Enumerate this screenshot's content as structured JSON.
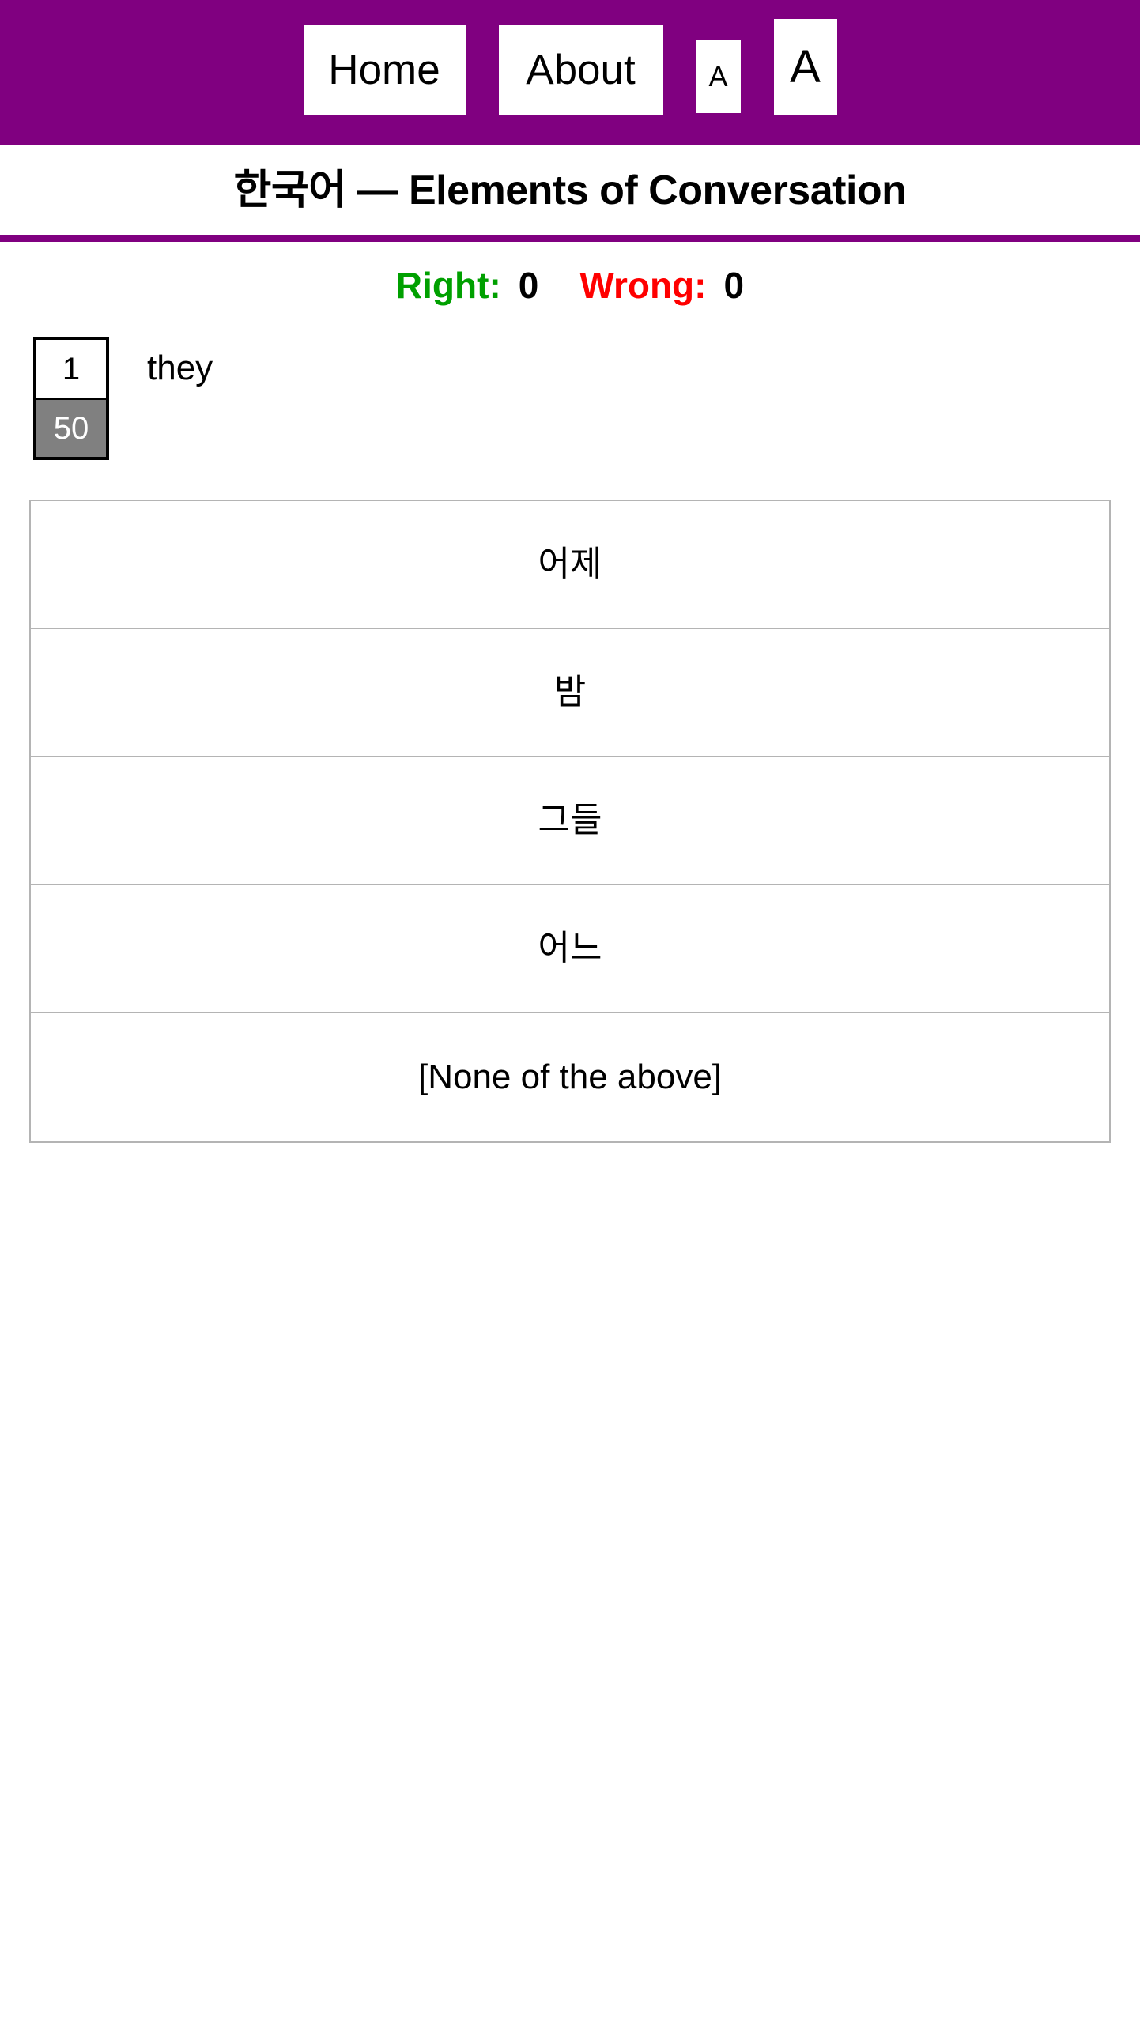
{
  "navbar": {
    "background_color": "#800080",
    "items": [
      {
        "label": "Home",
        "name": "nav-home"
      },
      {
        "label": "About",
        "name": "nav-about"
      },
      {
        "label": "A",
        "name": "font-decrease"
      },
      {
        "label": "A",
        "name": "font-increase"
      }
    ]
  },
  "header": {
    "title": "한국어 — Elements of Conversation",
    "rule_color": "#800080"
  },
  "score": {
    "right_label": "Right:",
    "right_value": "0",
    "right_color": "#00a000",
    "wrong_label": "Wrong:",
    "wrong_value": "0",
    "wrong_color": "#ff0000"
  },
  "question": {
    "current_index": "1",
    "total": "50",
    "prompt": "they",
    "counter_top_bg": "#ffffff",
    "counter_bottom_bg": "#808080"
  },
  "options": [
    {
      "label": "어제"
    },
    {
      "label": "밤"
    },
    {
      "label": "그들"
    },
    {
      "label": "어느"
    },
    {
      "label": "[None of the above]"
    }
  ]
}
